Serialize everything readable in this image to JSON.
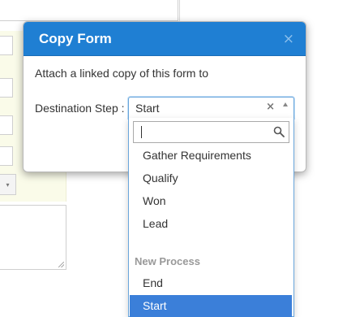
{
  "modal": {
    "title": "Copy Form",
    "close_glyph": "×",
    "message": "Attach a linked copy of this form to",
    "destination_label": "Destination Step :"
  },
  "select": {
    "current_value": "Start",
    "clear_glyph": "×",
    "search_placeholder": "",
    "groups": [
      {
        "label": "",
        "options": [
          "Gather Requirements",
          "Qualify",
          "Won",
          "Lead"
        ]
      },
      {
        "label": "New Process",
        "options": [
          "End",
          "Start"
        ]
      }
    ],
    "highlighted_option": "Start"
  },
  "background": {
    "select_arrow_glyph": "▾"
  },
  "colors": {
    "header_bg": "#1f7fd3",
    "highlight_bg": "#3b7fd9",
    "focus_border": "#6aa6dc"
  }
}
